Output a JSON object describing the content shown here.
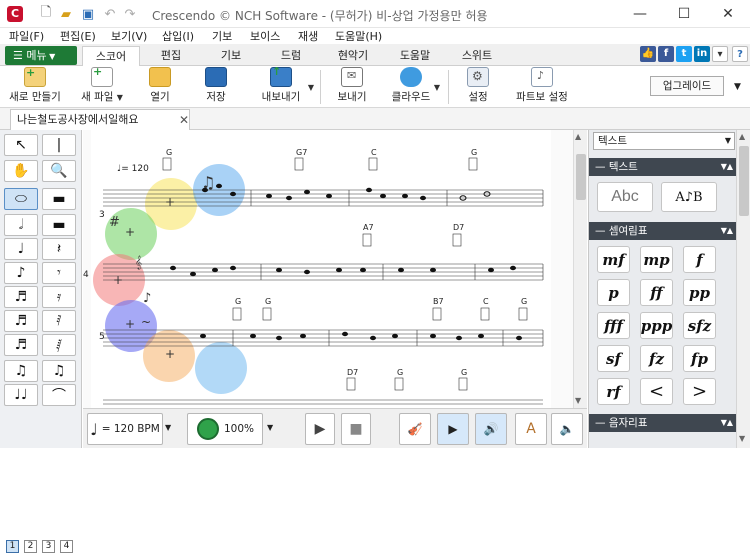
{
  "window": {
    "title": "Crescendo © NCH Software - (무허가) 비-상업 가정용만 허용",
    "controls": [
      "—",
      "☐",
      "✕"
    ]
  },
  "menu": [
    "파일(F)",
    "편집(E)",
    "보기(V)",
    "삽입(I)",
    "기보",
    "보이스",
    "재생",
    "도움말(H)"
  ],
  "ribbon": {
    "menu_button": "메뉴",
    "tabs": [
      "스코어",
      "편집",
      "기보",
      "드럼",
      "현악기",
      "도움말",
      "스위트"
    ],
    "active_tab": "스코어"
  },
  "toolbar": {
    "new_score": "새로 만들기",
    "new_file": "새 파일",
    "open": "열기",
    "save": "저장",
    "export": "내보내기",
    "send": "보내기",
    "cloud": "클라우드",
    "settings": "설정",
    "part_settings": "파트보 설정",
    "upgrade": "업그레이드"
  },
  "document_tab": "나는철도공사장에서일해요",
  "score": {
    "tempo": "= 120",
    "measure_numbers": [
      "3",
      "4",
      "5"
    ],
    "chords_row1": [
      "G",
      "G7",
      "C",
      "G"
    ],
    "chords_row2": [
      "A7",
      "D7"
    ],
    "chords_row3": [
      "G",
      "G",
      "B7",
      "C",
      "G"
    ],
    "chords_row4": [
      "D7",
      "G",
      "G"
    ]
  },
  "palette": {
    "pages": [
      "1",
      "2",
      "3",
      "4"
    ],
    "active_page": "1"
  },
  "bottom": {
    "tempo": "= 120 BPM",
    "volume": "100%",
    "volume_level": 1.0
  },
  "right_panel": {
    "select": "텍스트",
    "sections": [
      "텍스트",
      "셈여림표",
      "음자리표"
    ],
    "dynamics": [
      "mf",
      "mp",
      "f",
      "p",
      "ff",
      "pp",
      "fff",
      "ppp",
      "sfz",
      "sf",
      "fz",
      "fp",
      "rf",
      "<",
      ">"
    ]
  },
  "colors": {
    "menu_green": "#1e7a36",
    "section_header": "#3f4750",
    "app_red": "#c8102e"
  }
}
